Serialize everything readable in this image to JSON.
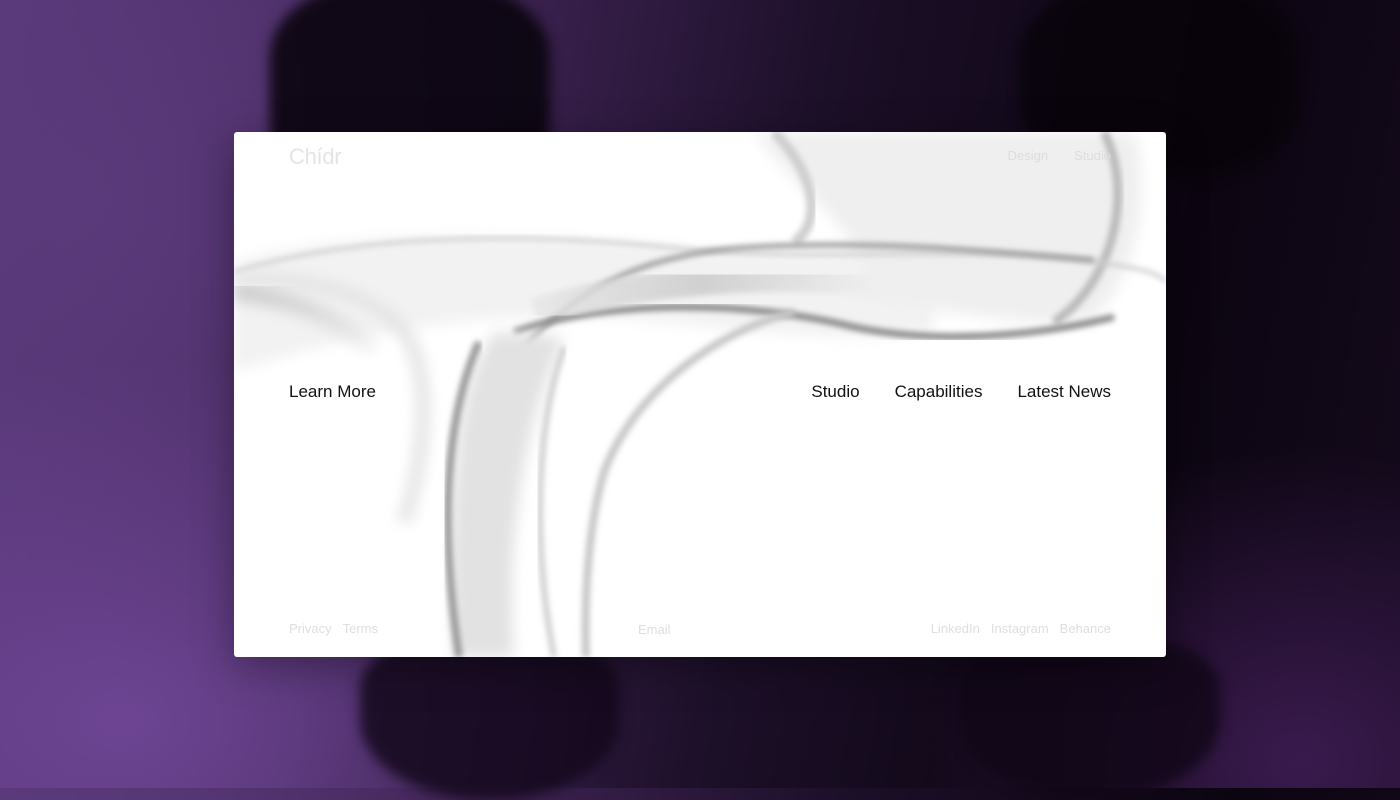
{
  "brand": {
    "logo": "Chídr"
  },
  "top_nav": {
    "items": [
      "Design",
      "Studio"
    ]
  },
  "hero": {
    "cta_label": "Learn More"
  },
  "main_nav": {
    "items": [
      "Studio",
      "Capabilities",
      "Latest News"
    ]
  },
  "footer": {
    "legal": [
      "Privacy",
      "Terms"
    ],
    "contact": "Email",
    "social": [
      "LinkedIn",
      "Instagram",
      "Behance"
    ]
  },
  "colors": {
    "background_purple": "#5b3a7c",
    "background_dark": "#0c0511",
    "card": "#ffffff",
    "text": "#111111",
    "muted_text": "#dedede"
  }
}
